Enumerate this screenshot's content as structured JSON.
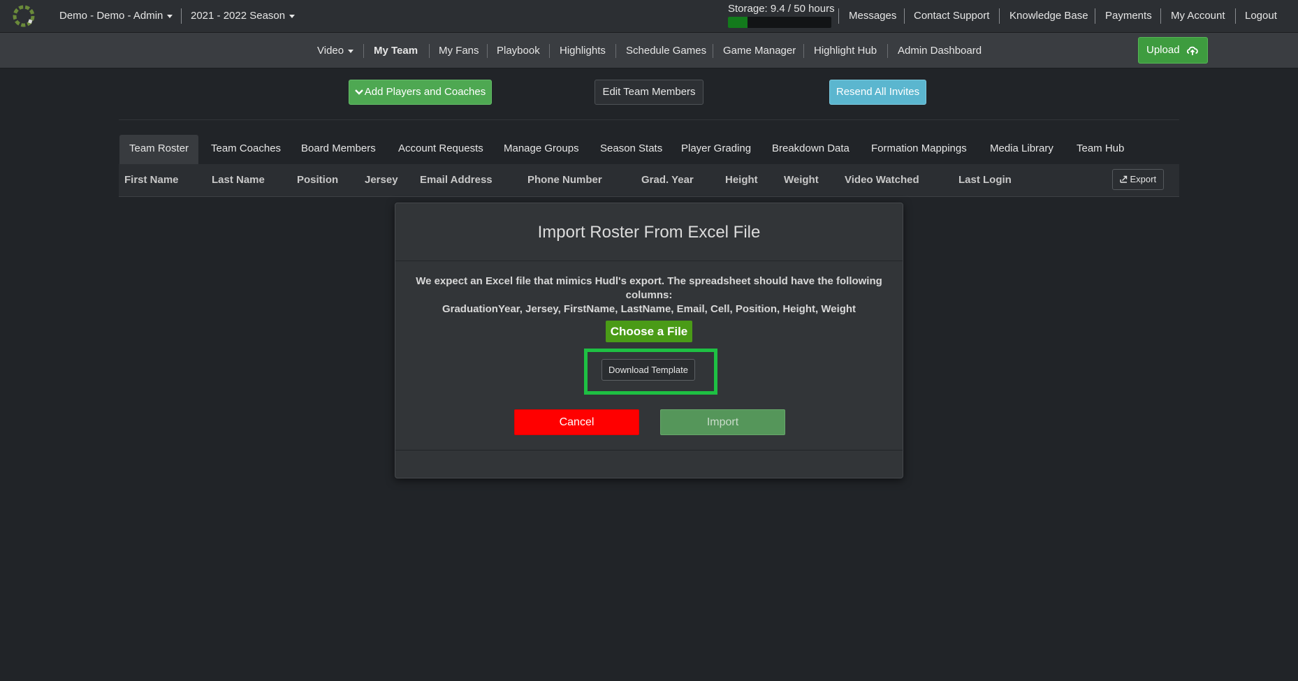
{
  "topbar": {
    "org_label": "Demo - Demo - Admin",
    "season_label": "2021 - 2022 Season",
    "storage_label": "Storage: 9.4 / 50 hours",
    "storage_used_fraction": 0.188,
    "storage_color": "#137a1c",
    "links": [
      "Messages",
      "Contact Support",
      "Knowledge Base",
      "Payments",
      "My Account",
      "Logout"
    ]
  },
  "nav": {
    "items": [
      "Video",
      "My Team",
      "My Fans",
      "Playbook",
      "Highlights",
      "Schedule Games",
      "Game Manager",
      "Highlight Hub",
      "Admin Dashboard"
    ],
    "active": "My Team",
    "upload_label": "Upload",
    "upload_icon": "cloud-upload-icon"
  },
  "actions": {
    "add_label": "Add Players and Coaches",
    "add_icon": "chevron-down-icon",
    "edit_label": "Edit Team Members",
    "resend_label": "Resend All Invites"
  },
  "tabs": {
    "items": [
      "Team Roster",
      "Team Coaches",
      "Board Members",
      "Account Requests",
      "Manage Groups",
      "Season Stats",
      "Player Grading",
      "Breakdown Data",
      "Formation Mappings",
      "Media Library",
      "Team Hub"
    ],
    "active": "Team Roster"
  },
  "table": {
    "columns": [
      "First Name",
      "Last Name",
      "Position",
      "Jersey",
      "Email Address",
      "Phone Number",
      "Grad. Year",
      "Height",
      "Weight",
      "Video Watched",
      "Last Login"
    ],
    "export_label": "Export",
    "export_icon": "export-icon"
  },
  "modal": {
    "title": "Import Roster From Excel File",
    "desc_line1": "We expect an Excel file that mimics Hudl's export. The spreadsheet should have the following columns:",
    "desc_line2": "GraduationYear, Jersey, FirstName, LastName, Email, Cell, Position, Height, Weight",
    "choose_label": "Choose a File",
    "download_label": "Download Template",
    "cancel_label": "Cancel",
    "import_label": "Import",
    "highlight_color": "#1ec043",
    "cancel_color": "#ff0000"
  }
}
